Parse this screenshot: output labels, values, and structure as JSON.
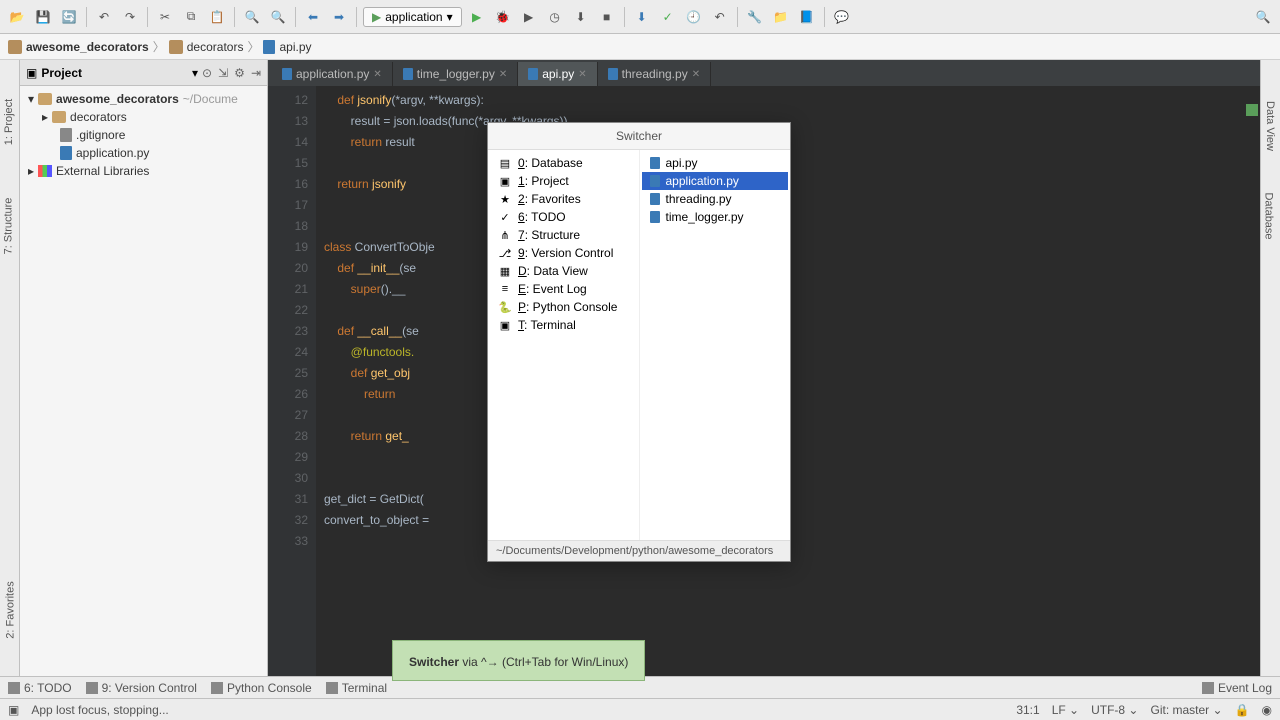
{
  "toolbar": {
    "run_config": "application"
  },
  "breadcrumb": {
    "root": "awesome_decorators",
    "folder": "decorators",
    "file": "api.py"
  },
  "project_panel": {
    "title": "Project",
    "root": "awesome_decorators",
    "root_path": "~/Docume",
    "items": {
      "decorators": "decorators",
      "gitignore": ".gitignore",
      "application": "application.py",
      "external": "External Libraries"
    }
  },
  "tabs": [
    {
      "label": "application.py"
    },
    {
      "label": "time_logger.py"
    },
    {
      "label": "api.py"
    },
    {
      "label": "threading.py"
    }
  ],
  "code": {
    "lines": [
      "    def jsonify(*argv, **kwargs):",
      "        result = json.loads(func(*argv, **kwargs))",
      "        return result",
      "",
      "    return jsonify",
      "",
      "",
      "class ConvertToObje",
      "    def __init__(se",
      "        super().__",
      "",
      "    def __call__(se",
      "        @functools.",
      "        def get_obj",
      "            return",
      "",
      "        return get_",
      "",
      "",
      "get_dict = GetDict(",
      "convert_to_object =",
      ""
    ],
    "line_start": 12
  },
  "switcher": {
    "title": "Switcher",
    "tool_windows": [
      {
        "key": "0",
        "label": "Database"
      },
      {
        "key": "1",
        "label": "Project"
      },
      {
        "key": "2",
        "label": "Favorites"
      },
      {
        "key": "6",
        "label": "TODO"
      },
      {
        "key": "7",
        "label": "Structure"
      },
      {
        "key": "9",
        "label": "Version Control"
      },
      {
        "key": "D",
        "label": "Data View"
      },
      {
        "key": "E",
        "label": "Event Log"
      },
      {
        "key": "P",
        "label": "Python Console"
      },
      {
        "key": "T",
        "label": "Terminal"
      }
    ],
    "files": [
      {
        "label": "api.py"
      },
      {
        "label": "application.py"
      },
      {
        "label": "threading.py"
      },
      {
        "label": "time_logger.py"
      }
    ],
    "footer": "~/Documents/Development/python/awesome_decorators"
  },
  "tooltip": {
    "title": "Switcher",
    "rest": " via ^→ (Ctrl+Tab for Win/Linux)"
  },
  "left_strip": {
    "project": "1: Project",
    "structure": "7: Structure",
    "favorites": "2: Favorites"
  },
  "right_strip": {
    "dataview": "Data View",
    "database": "Database"
  },
  "bottom_tools": {
    "todo": "6: TODO",
    "vcs": "9: Version Control",
    "python_console": "Python Console",
    "terminal": "Terminal",
    "event_log": "Event Log"
  },
  "status": {
    "msg": "App lost focus, stopping...",
    "pos": "31:1",
    "line_ending": "LF",
    "encoding": "UTF-8",
    "git": "Git: master"
  }
}
